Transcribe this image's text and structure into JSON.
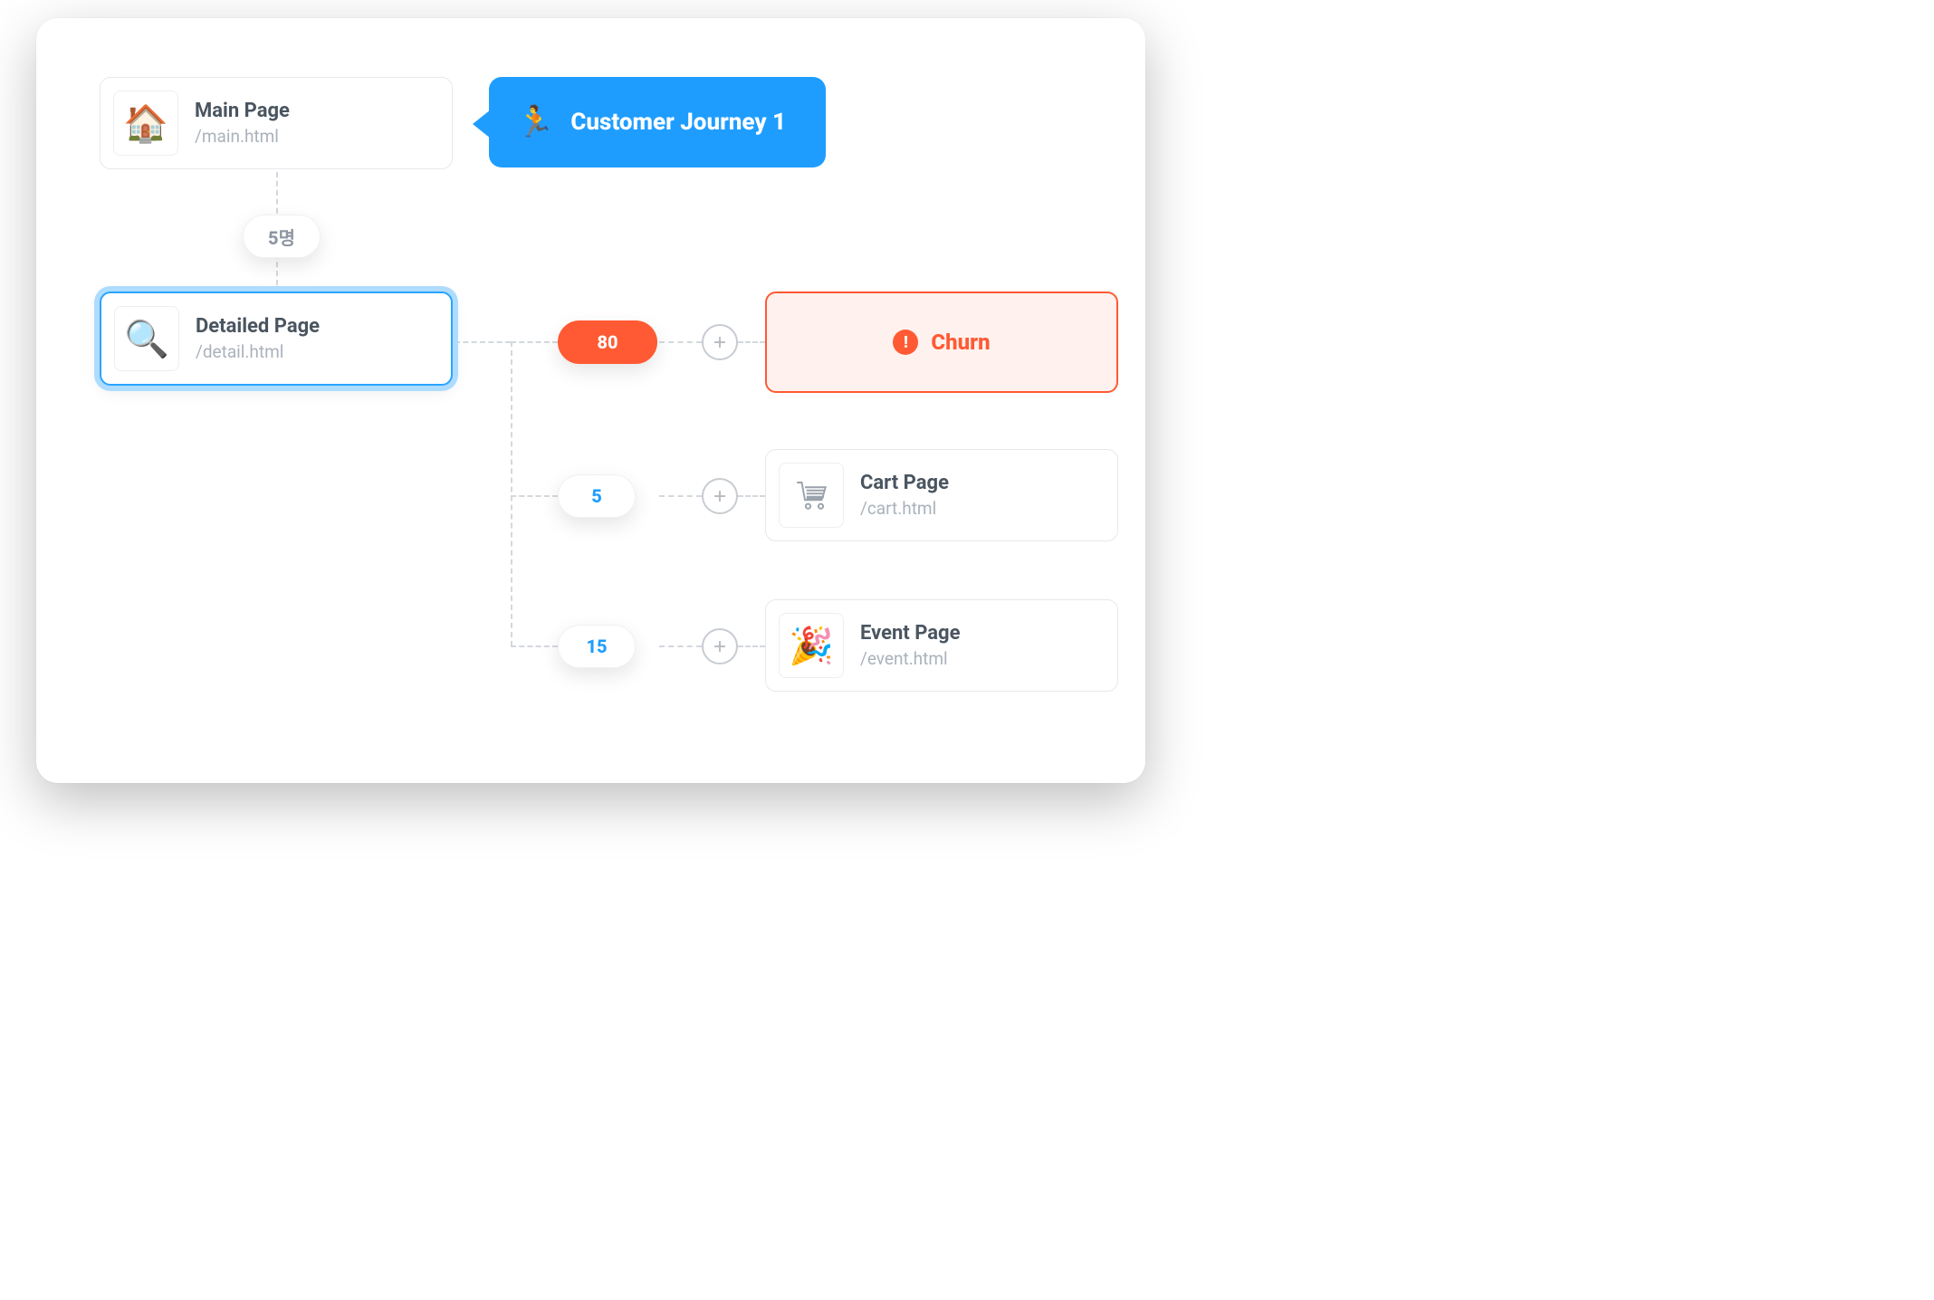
{
  "journey": {
    "title": "Customer Journey 1"
  },
  "nodes": {
    "main": {
      "title": "Main Page",
      "path": "/main.html"
    },
    "detail": {
      "title": "Detailed Page",
      "path": "/detail.html"
    },
    "cart": {
      "title": "Cart Page",
      "path": "/cart.html"
    },
    "event": {
      "title": "Event Page",
      "path": "/event.html"
    }
  },
  "churn": {
    "label": "Churn"
  },
  "counts": {
    "main_to_detail": "5명",
    "detail_to_churn": "80",
    "detail_to_cart": "5",
    "detail_to_event": "15"
  }
}
